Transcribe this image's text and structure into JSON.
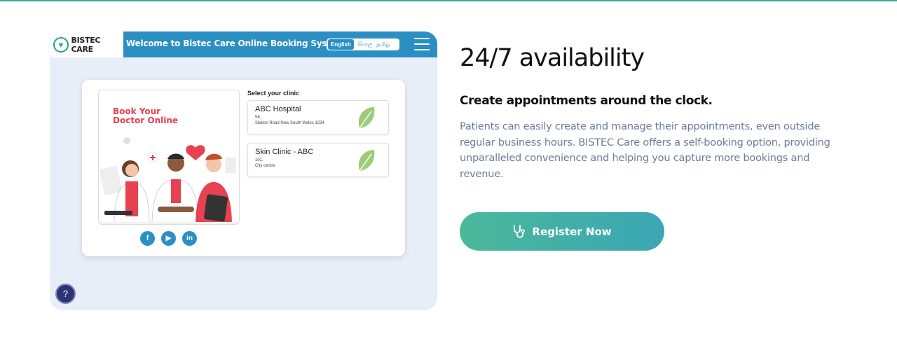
{
  "mockup": {
    "logo_text": "BISTEC CARE",
    "header_title": "Welcome to Bistec Care Online Booking System",
    "languages": [
      "English",
      "සිංහල",
      "தமிழ்"
    ],
    "promo_title_line1": "Book Your",
    "promo_title_line2": "Doctor Online",
    "select_clinic_label": "Select your clinic",
    "clinics": [
      {
        "name": "ABC Hospital",
        "addr1": "56,",
        "addr2": "Station Road New South Wales 1234"
      },
      {
        "name": "Skin Clinic - ABC",
        "addr1": "101,",
        "addr2": "City centre"
      }
    ],
    "socials": [
      "f",
      "▶",
      "in"
    ],
    "help_icon": "?"
  },
  "feature": {
    "title": "24/7 availability",
    "subtitle": "Create appointments around the clock.",
    "description": "Patients can easily create and manage their appointments, even outside regular business hours. BISTEC Care offers a self-booking option, providing unparalleled convenience and helping you capture more bookings and revenue.",
    "register_label": "Register Now"
  },
  "colors": {
    "accent_teal": "#3aa99a",
    "header_blue": "#2b8fc4",
    "promo_red": "#e8414f"
  }
}
